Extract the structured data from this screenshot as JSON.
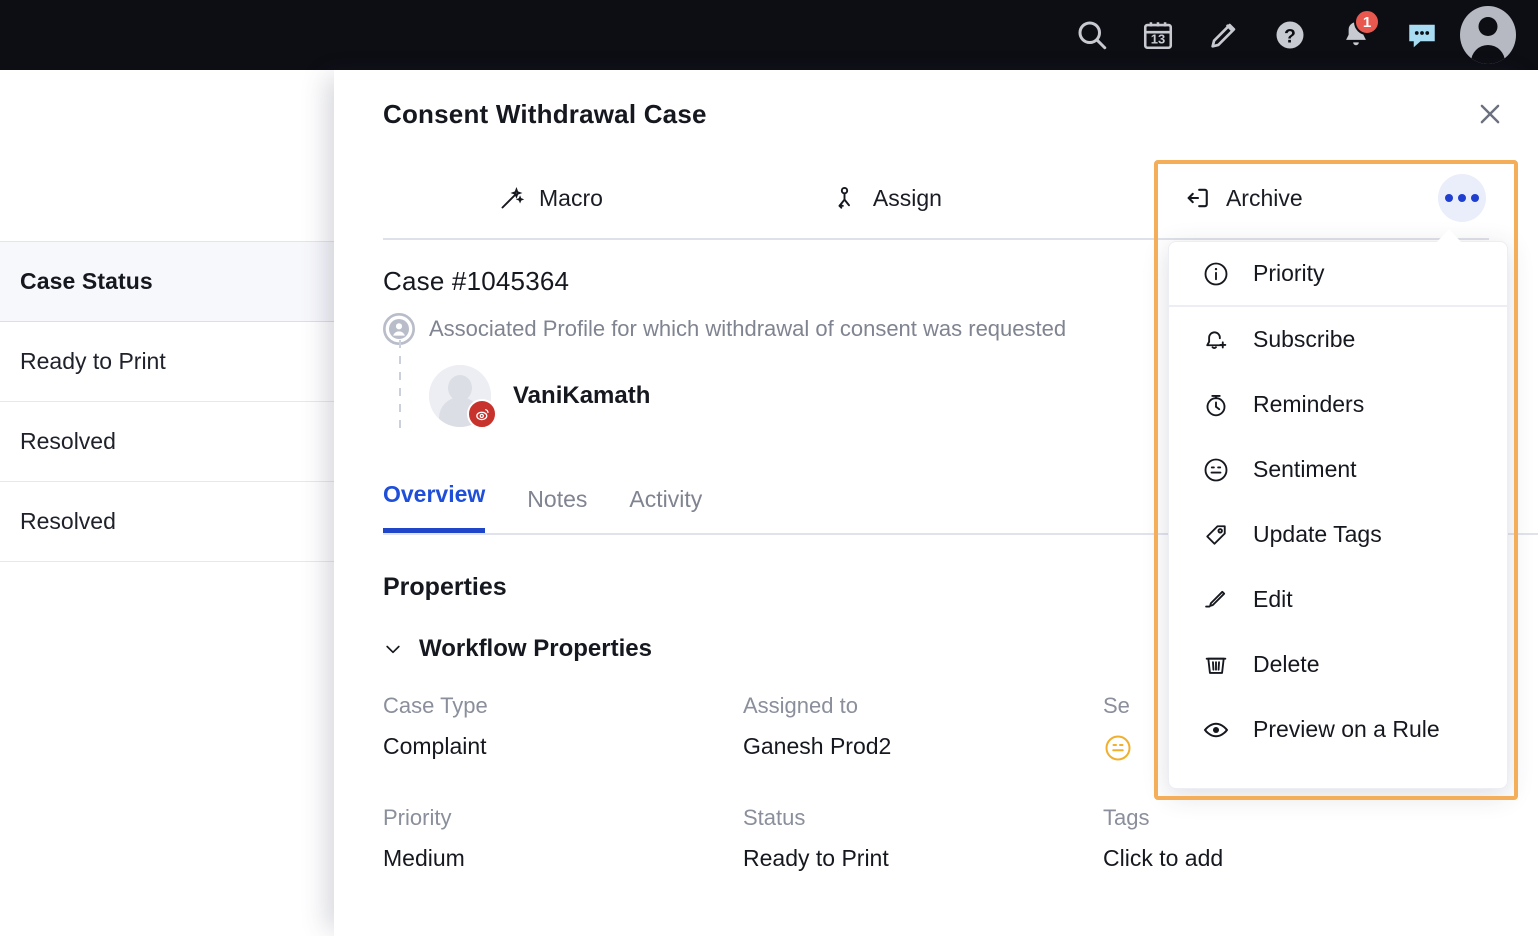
{
  "topbar": {
    "icons": [
      {
        "name": "search-icon",
        "label": "Search"
      },
      {
        "name": "calendar-icon",
        "label": "Calendar",
        "day": "13"
      },
      {
        "name": "pencil-icon",
        "label": "Compose"
      },
      {
        "name": "help-icon",
        "label": "Help"
      },
      {
        "name": "bell-icon",
        "label": "Notifications",
        "badge": "1"
      },
      {
        "name": "chat-icon",
        "label": "Chat"
      },
      {
        "name": "user-avatar-icon",
        "label": "Account"
      }
    ],
    "notification_count": "1",
    "calendar_day": "13"
  },
  "left_list": {
    "header": "Case Status",
    "rows": [
      "Ready to Print",
      "Resolved",
      "Resolved"
    ]
  },
  "panel": {
    "title": "Consent Withdrawal Case",
    "close_label": "×"
  },
  "actions": {
    "macro": "Macro",
    "assign": "Assign",
    "archive": "Archive",
    "more_label": "More options"
  },
  "case": {
    "id": "Case #1045364",
    "associated_text": "Associated Profile for which withdrawal of consent was requested",
    "profile_name": "VaniKamath"
  },
  "tabs": [
    {
      "label": "Overview",
      "active": true
    },
    {
      "label": "Notes",
      "active": false
    },
    {
      "label": "Activity",
      "active": false
    }
  ],
  "properties": {
    "title": "Properties",
    "section": "Workflow Properties",
    "fields": [
      {
        "label": "Case Type",
        "value": "Complaint"
      },
      {
        "label": "Assigned to",
        "value": "Ganesh Prod2"
      },
      {
        "label": "Se",
        "value": "",
        "icon": "sentiment-neutral-icon"
      },
      {
        "label": "Priority",
        "value": "Medium"
      },
      {
        "label": "Status",
        "value": "Ready to Print"
      },
      {
        "label": "Tags",
        "value": "Click to add"
      }
    ]
  },
  "menu": {
    "items": [
      {
        "label": "Priority",
        "icon": "info-circle-icon",
        "divider": true
      },
      {
        "label": "Subscribe",
        "icon": "bell-plus-icon",
        "divider": false
      },
      {
        "label": "Reminders",
        "icon": "stopwatch-icon",
        "divider": false
      },
      {
        "label": "Sentiment",
        "icon": "smiley-icon",
        "divider": false
      },
      {
        "label": "Update Tags",
        "icon": "tag-icon",
        "divider": false
      },
      {
        "label": "Edit",
        "icon": "pencil-edit-icon",
        "divider": false
      },
      {
        "label": "Delete",
        "icon": "trash-icon",
        "divider": false
      },
      {
        "label": "Preview on a Rule",
        "icon": "eye-icon",
        "divider": false
      }
    ]
  },
  "colors": {
    "accent_blue": "#1f46c8",
    "highlight_orange": "#f4ad59",
    "topbar_black": "#0d0e14",
    "badge_red": "#e8584f",
    "social_red": "#c8322c"
  }
}
